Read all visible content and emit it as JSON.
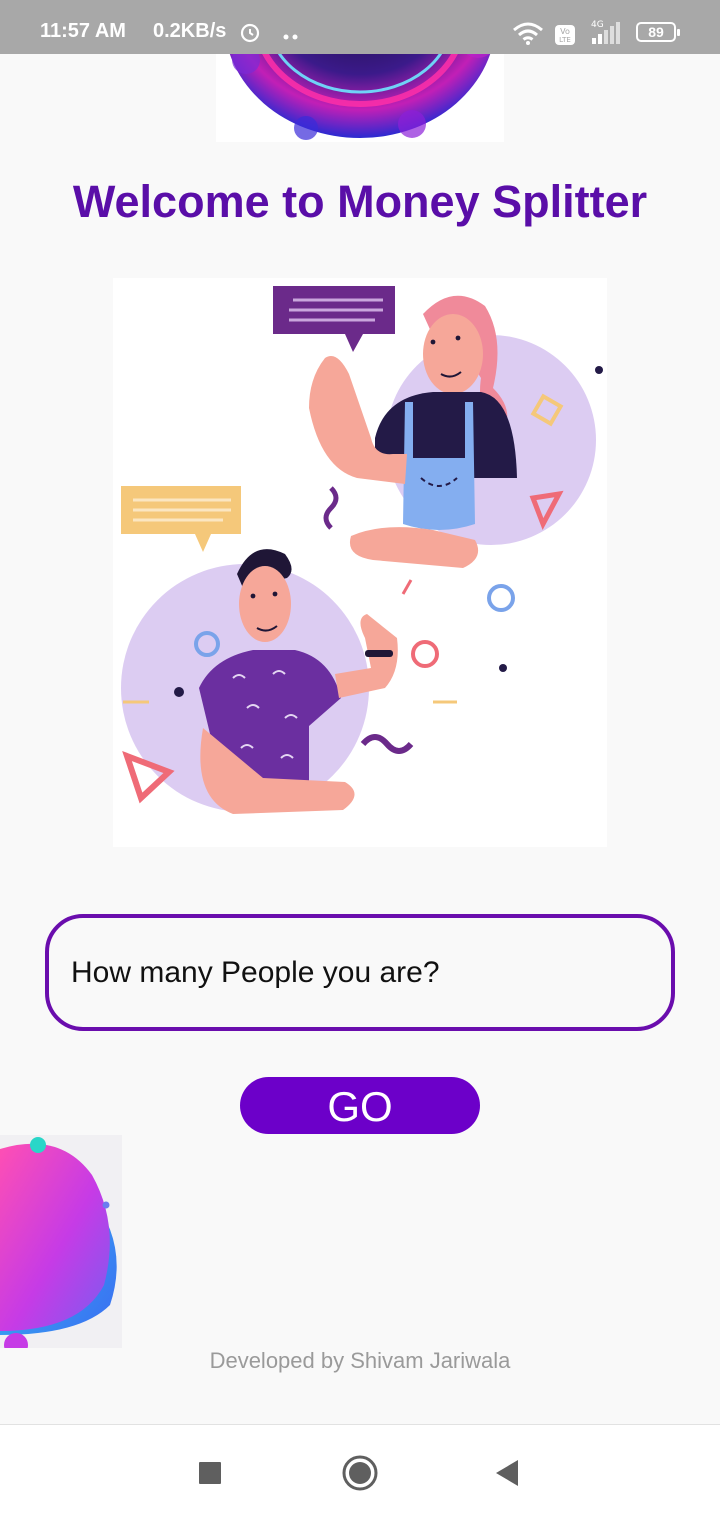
{
  "status_bar": {
    "time": "11:57 AM",
    "network_speed": "0.2KB/s",
    "icons": [
      "alarm-icon",
      "more-dots-icon",
      "wifi-icon",
      "volte-icon",
      "signal-4g-icon",
      "battery-icon"
    ],
    "network_type": "4G",
    "volte_label": "Vo LTE",
    "battery_level": "89"
  },
  "header": {
    "title": "Welcome to Money Splitter"
  },
  "form": {
    "people_placeholder": "How many People you are?",
    "people_value": "",
    "go_label": "GO"
  },
  "footer": {
    "credit": "Developed by Shivam Jariwala"
  },
  "nav_bar": {
    "icons": [
      "recents-square-icon",
      "home-circle-icon",
      "back-triangle-icon"
    ]
  },
  "colors": {
    "title": "#5a0ea8",
    "input_border": "#6a0dad",
    "button_bg": "#6c00c9",
    "footer_text": "#9a9a9a",
    "status_bar_bg": "#a8a8a8"
  }
}
